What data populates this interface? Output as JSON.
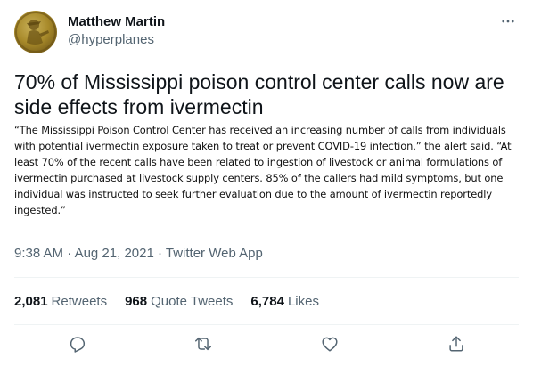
{
  "user": {
    "display_name": "Matthew Martin",
    "handle": "@hyperplanes"
  },
  "tweet": {
    "text": "70% of Mississippi poison control center calls now are side effects from ivermectin",
    "quote": "“The Mississippi Poison Control Center has received an increasing number of calls from individuals with potential ivermectin exposure taken to treat or prevent COVID-19 infection,” the alert said. “At least 70% of the recent calls have been related to ingestion of livestock or animal formulations of ivermectin purchased at livestock supply centers. 85% of the callers had mild symptoms, but one individual was instructed to seek further evaluation due to the amount of ivermectin reportedly ingested.”"
  },
  "meta": {
    "time": "9:38 AM",
    "separator1": " · ",
    "date": "Aug 21, 2021",
    "separator2": " · ",
    "source": "Twitter Web App"
  },
  "stats": {
    "retweets_count": "2,081",
    "retweets_label": "Retweets",
    "quotes_count": "968",
    "quotes_label": "Quote Tweets",
    "likes_count": "6,784",
    "likes_label": "Likes"
  },
  "icons": {
    "more": "more-icon",
    "reply": "reply-icon",
    "retweet": "retweet-icon",
    "like": "heart-icon",
    "share": "share-icon"
  },
  "colors": {
    "text": "#0f1419",
    "secondary": "#536471",
    "divider": "#eff3f4"
  }
}
